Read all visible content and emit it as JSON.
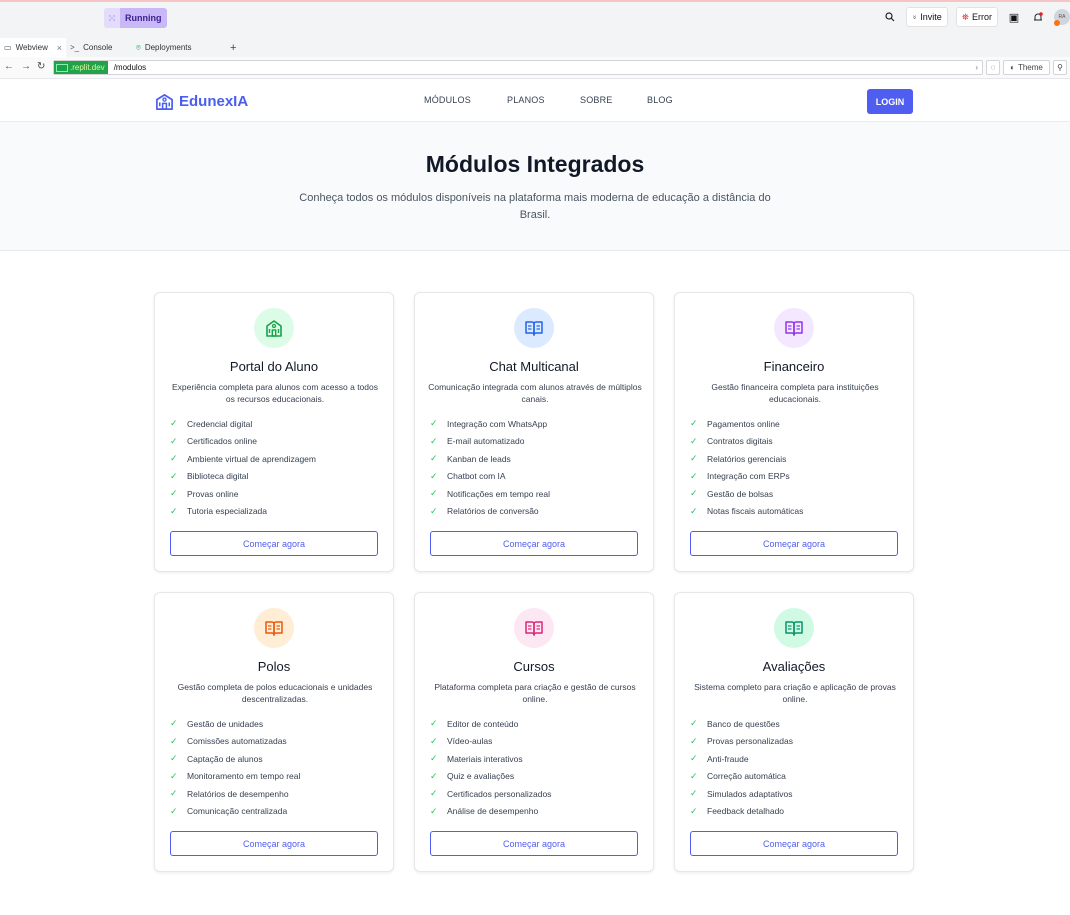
{
  "ide": {
    "run_status": "Running",
    "invite_label": "Invite",
    "error_label": "Error",
    "avatar_initials": "RA"
  },
  "tabs": [
    {
      "label": "Webview",
      "icon": "monitor-icon"
    },
    {
      "label": "Console",
      "icon": "terminal-icon"
    },
    {
      "label": "Deployments",
      "icon": "deploy-icon"
    }
  ],
  "urlbar": {
    "host": ".replit.dev",
    "path": "/modulos",
    "theme_label": "Theme"
  },
  "site": {
    "brand": "EdunexIA",
    "nav": [
      "MÓDULOS",
      "PLANOS",
      "SOBRE",
      "BLOG"
    ],
    "login": "LOGIN"
  },
  "hero": {
    "title": "Módulos Integrados",
    "subtitle": "Conheça todos os módulos disponíveis na plataforma mais moderna de educação a distância do Brasil."
  },
  "cta_label": "Começar agora",
  "modules": [
    {
      "title": "Portal do Aluno",
      "description": "Experiência completa para alunos com acesso a todos os recursos educacionais.",
      "icon": "building-icon",
      "icon_color": "#16a34a",
      "icon_bg": "#dcfce7",
      "features": [
        "Credencial digital",
        "Certificados online",
        "Ambiente virtual de aprendizagem",
        "Biblioteca digital",
        "Provas online",
        "Tutoria especializada"
      ]
    },
    {
      "title": "Chat Multicanal",
      "description": "Comunicação integrada com alunos através de múltiplos canais.",
      "icon": "book-icon",
      "icon_color": "#2563eb",
      "icon_bg": "#dbeafe",
      "features": [
        "Integração com WhatsApp",
        "E-mail automatizado",
        "Kanban de leads",
        "Chatbot com IA",
        "Notificações em tempo real",
        "Relatórios de conversão"
      ]
    },
    {
      "title": "Financeiro",
      "description": "Gestão financeira completa para instituições educacionais.",
      "icon": "book-icon",
      "icon_color": "#9333ea",
      "icon_bg": "#f3e8ff",
      "features": [
        "Pagamentos online",
        "Contratos digitais",
        "Relatórios gerenciais",
        "Integração com ERPs",
        "Gestão de bolsas",
        "Notas fiscais automáticas"
      ]
    },
    {
      "title": "Polos",
      "description": "Gestão completa de polos educacionais e unidades descentralizadas.",
      "icon": "book-icon",
      "icon_color": "#ea580c",
      "icon_bg": "#ffedd5",
      "features": [
        "Gestão de unidades",
        "Comissões automatizadas",
        "Captação de alunos",
        "Monitoramento em tempo real",
        "Relatórios de desempenho",
        "Comunicação centralizada"
      ]
    },
    {
      "title": "Cursos",
      "description": "Plataforma completa para criação e gestão de cursos online.",
      "icon": "book-icon",
      "icon_color": "#db2777",
      "icon_bg": "#fce7f3",
      "features": [
        "Editor de conteúdo",
        "Vídeo-aulas",
        "Materiais interativos",
        "Quiz e avaliações",
        "Certificados personalizados",
        "Análise de desempenho"
      ]
    },
    {
      "title": "Avaliações",
      "description": "Sistema completo para criação e aplicação de provas online.",
      "icon": "book-icon",
      "icon_color": "#059669",
      "icon_bg": "#d1fae5",
      "features": [
        "Banco de questões",
        "Provas personalizadas",
        "Anti-fraude",
        "Correção automática",
        "Simulados adaptativos",
        "Feedback detalhado"
      ]
    }
  ]
}
